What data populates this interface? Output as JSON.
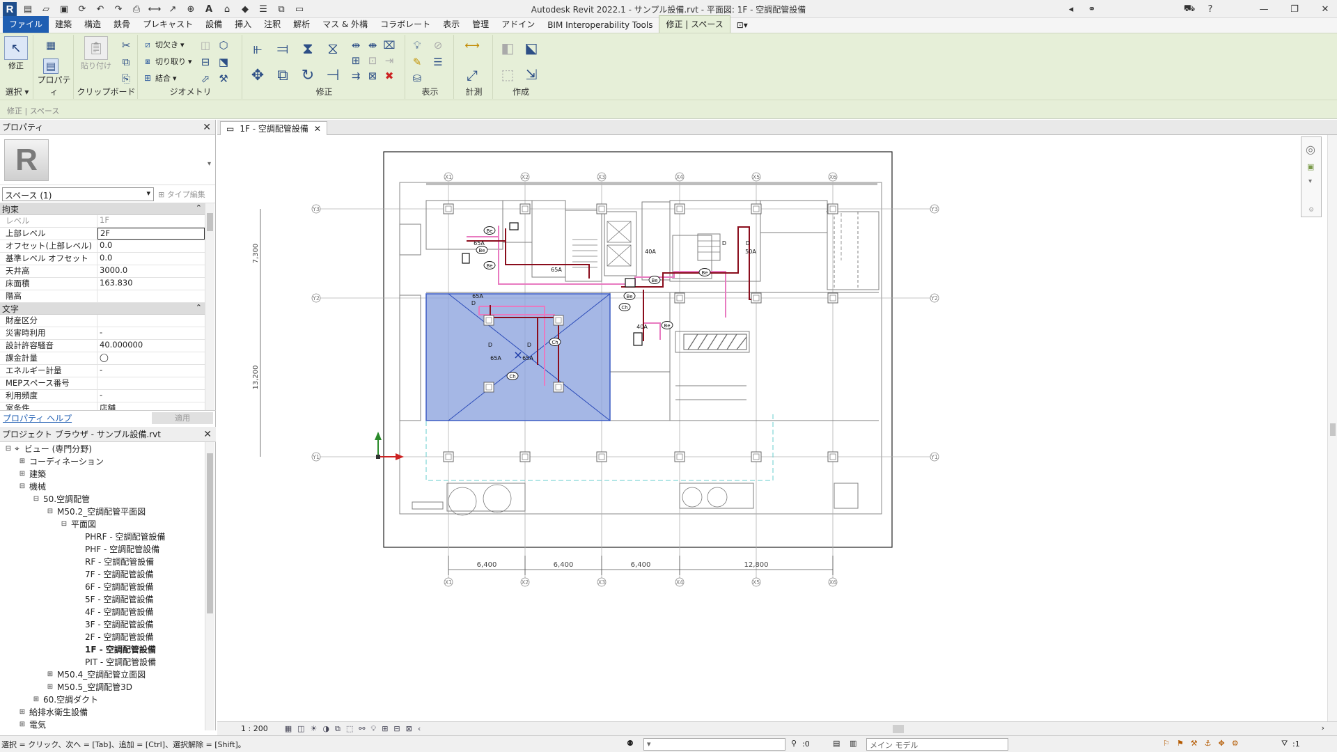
{
  "window": {
    "title": "Autodesk Revit 2022.1 - サンプル設備.rvt - 平面図: 1F - 空調配管設備"
  },
  "tabs": [
    "ファイル",
    "建築",
    "構造",
    "鉄骨",
    "プレキャスト",
    "設備",
    "挿入",
    "注釈",
    "解析",
    "マス & 外構",
    "コラボレート",
    "表示",
    "管理",
    "アドイン",
    "BIM Interoperability Tools",
    "修正 | スペース"
  ],
  "ribbon": {
    "select_label": "選択",
    "modify_label": "修正",
    "properties_label": "プロパティ",
    "paste_label": "貼り付け",
    "clipboard_label": "クリップボード",
    "cut_label": "切欠き",
    "cut2_label": "切り取り",
    "join_label": "結合",
    "geometry_label": "ジオメトリ",
    "modify_panel_label": "修正",
    "view_label": "表示",
    "measure_label": "計測",
    "create_label": "作成"
  },
  "options_bar": {
    "text": "修正 | スペース"
  },
  "properties": {
    "title": "プロパティ",
    "selector": "スペース (1)",
    "type_edit": "タイプ編集",
    "groups": [
      {
        "name": "拘束",
        "rows": [
          {
            "k": "レベル",
            "v": "1F",
            "dim": true
          },
          {
            "k": "上部レベル",
            "v": "2F",
            "edit": true
          },
          {
            "k": "オフセット(上部レベル)",
            "v": "0.0"
          },
          {
            "k": "基準レベル オフセット",
            "v": "0.0"
          },
          {
            "k": "天井高",
            "v": "3000.0"
          },
          {
            "k": "床面積",
            "v": "163.830"
          },
          {
            "k": "階高",
            "v": ""
          }
        ]
      },
      {
        "name": "文字",
        "rows": [
          {
            "k": "財産区分",
            "v": ""
          },
          {
            "k": "災害時利用",
            "v": "-"
          },
          {
            "k": "設計許容騒音",
            "v": "40.000000"
          },
          {
            "k": "課金計量",
            "v": "◯"
          },
          {
            "k": "エネルギー計量",
            "v": "-"
          },
          {
            "k": "MEPスペース番号",
            "v": ""
          },
          {
            "k": "利用頻度",
            "v": "-"
          },
          {
            "k": "室条件",
            "v": "店舗"
          }
        ]
      }
    ],
    "help_link": "プロパティ ヘルプ",
    "apply": "適用"
  },
  "browser": {
    "title": "プロジェクト ブラウザ - サンプル設備.rvt",
    "nodes": [
      {
        "t": "ビュー (専門分野)",
        "lvl": 0,
        "tg": "⊟",
        "icon": "⌖"
      },
      {
        "t": "コーディネーション",
        "lvl": 1,
        "tg": "⊞"
      },
      {
        "t": "建築",
        "lvl": 1,
        "tg": "⊞"
      },
      {
        "t": "機械",
        "lvl": 1,
        "tg": "⊟"
      },
      {
        "t": "50.空調配管",
        "lvl": 2,
        "tg": "⊟"
      },
      {
        "t": "M50.2_空調配管平面図",
        "lvl": 3,
        "tg": "⊟"
      },
      {
        "t": "平面図",
        "lvl": 4,
        "tg": "⊟"
      },
      {
        "t": "PHRF - 空調配管設備",
        "lvl": 5,
        "tg": ""
      },
      {
        "t": "PHF - 空調配管設備",
        "lvl": 5,
        "tg": ""
      },
      {
        "t": "RF - 空調配管設備",
        "lvl": 5,
        "tg": ""
      },
      {
        "t": "7F - 空調配管設備",
        "lvl": 5,
        "tg": ""
      },
      {
        "t": "6F - 空調配管設備",
        "lvl": 5,
        "tg": ""
      },
      {
        "t": "5F - 空調配管設備",
        "lvl": 5,
        "tg": ""
      },
      {
        "t": "4F - 空調配管設備",
        "lvl": 5,
        "tg": ""
      },
      {
        "t": "3F - 空調配管設備",
        "lvl": 5,
        "tg": ""
      },
      {
        "t": "2F - 空調配管設備",
        "lvl": 5,
        "tg": ""
      },
      {
        "t": "1F - 空調配管設備",
        "lvl": 5,
        "tg": "",
        "cur": true
      },
      {
        "t": "PIT - 空調配管設備",
        "lvl": 5,
        "tg": ""
      },
      {
        "t": "M50.4_空調配管立面図",
        "lvl": 3,
        "tg": "⊞"
      },
      {
        "t": "M50.5_空調配管3D",
        "lvl": 3,
        "tg": "⊞"
      },
      {
        "t": "60.空調ダクト",
        "lvl": 2,
        "tg": "⊞"
      },
      {
        "t": "給排水衛生設備",
        "lvl": 1,
        "tg": "⊞"
      },
      {
        "t": "電気",
        "lvl": 1,
        "tg": "⊞"
      }
    ]
  },
  "view_tab": {
    "label": "1F - 空調配管設備"
  },
  "drawing": {
    "grid_x": [
      "X1",
      "X2",
      "X3",
      "X4",
      "X5",
      "X6"
    ],
    "grid_y": [
      "Y3",
      "Y2",
      "Y1"
    ],
    "dims_bottom": [
      "6,400",
      "6,400",
      "6,400",
      "12,800"
    ],
    "dims_left": [
      "7,300",
      "13,200"
    ],
    "tags": [
      "65A",
      "65A",
      "65A",
      "65A",
      "65A",
      "40A",
      "50A",
      "40A",
      "D",
      "D",
      "D",
      "D",
      "D",
      "Be",
      "Be",
      "Be",
      "Be",
      "Be",
      "Be",
      "Be",
      "Ch",
      "Ch",
      "Ch"
    ]
  },
  "view_control": {
    "scale": "1 : 200"
  },
  "status": {
    "message": "選択 = クリック、次へ = [Tab]、追加 = [Ctrl]、選択解除 = [Shift]。",
    "count": ":0",
    "model": "メイン モデル",
    "filter": ":1"
  }
}
